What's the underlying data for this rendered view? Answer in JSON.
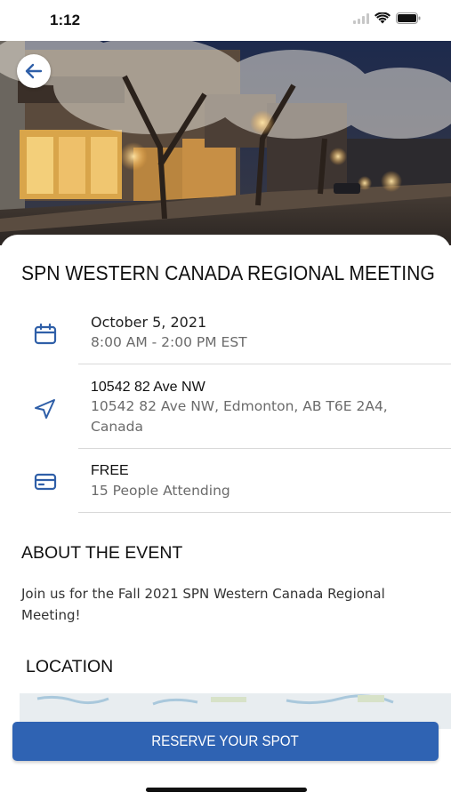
{
  "status_bar": {
    "time": "1:12"
  },
  "hero": {
    "image_description_icon": "city-street-night-photo",
    "back_icon": "arrow-left-icon"
  },
  "event": {
    "title": "SPN WESTERN CANADA REGIONAL MEETING",
    "date": {
      "icon": "calendar-icon",
      "line1": "October 5, 2021",
      "line2": "8:00 AM - 2:00 PM EST"
    },
    "location": {
      "icon": "navigation-arrow-icon",
      "line1": "10542 82 Ave NW",
      "line2": "10542 82 Ave NW, Edmonton, AB T6E 2A4, Canada"
    },
    "price": {
      "icon": "credit-card-icon",
      "line1": "FREE",
      "line2": "15 People Attending"
    }
  },
  "about": {
    "heading": "ABOUT THE EVENT",
    "text": "Join us for the Fall 2021 SPN Western Canada Regional Meeting!"
  },
  "location_section": {
    "heading": "LOCATION"
  },
  "cta": {
    "label": "RESERVE YOUR SPOT"
  },
  "colors": {
    "accent": "#2f63b3",
    "icon": "#2f5fa8",
    "secondary_text": "#6b6b6b",
    "divider": "#d9d9d9"
  }
}
